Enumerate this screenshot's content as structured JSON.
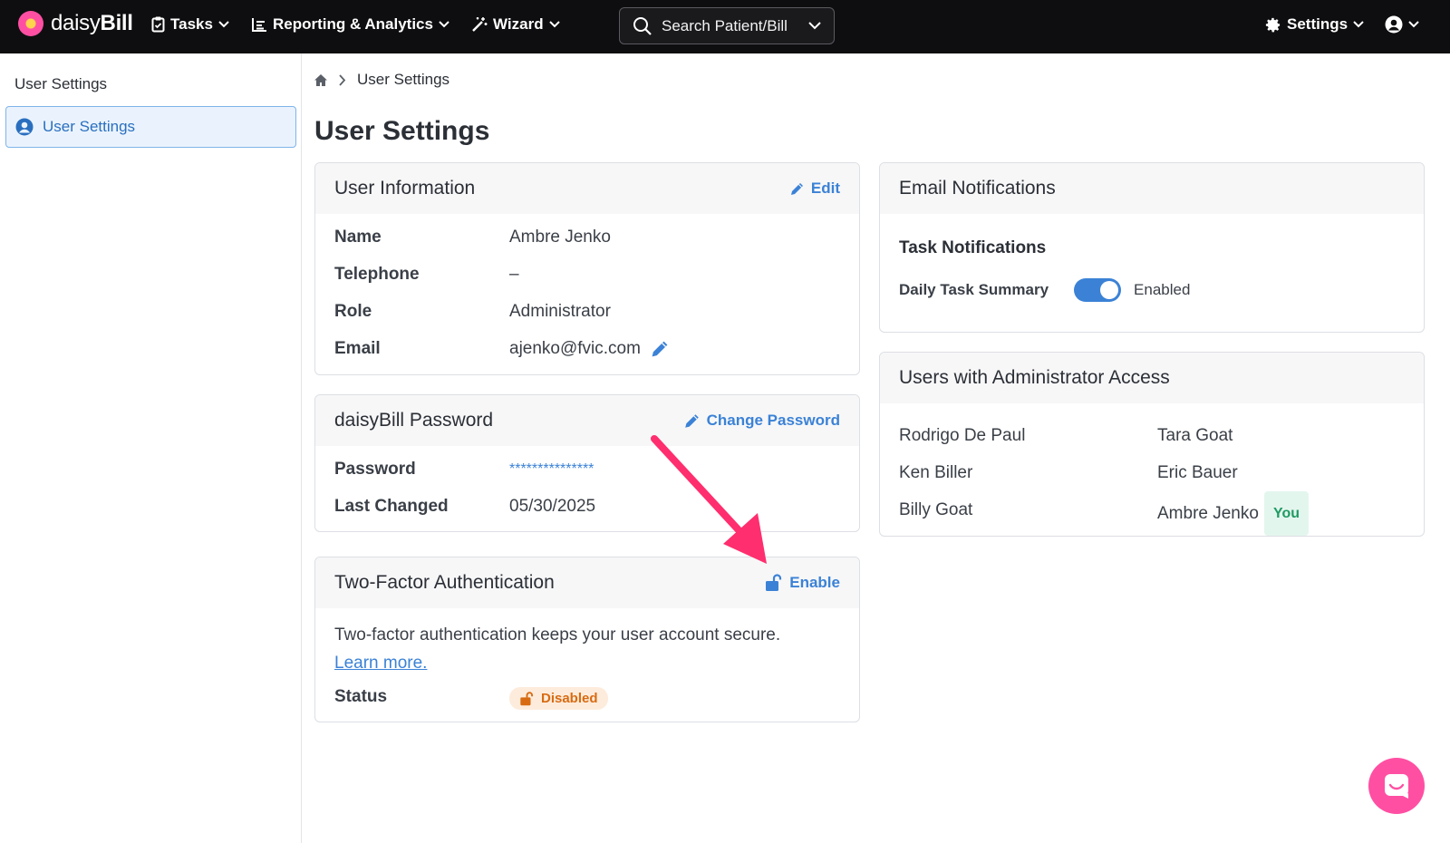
{
  "nav": {
    "logo_light": "daisy",
    "logo_bold": "Bill",
    "tasks": "Tasks",
    "reporting": "Reporting & Analytics",
    "wizard": "Wizard",
    "search_placeholder": "Search Patient/Bill",
    "settings": "Settings"
  },
  "sidebar": {
    "title": "User Settings",
    "items": [
      {
        "label": "User Settings"
      }
    ]
  },
  "breadcrumb": {
    "current": "User Settings"
  },
  "page_title": "User Settings",
  "user_info": {
    "title": "User Information",
    "action": "Edit",
    "rows": [
      {
        "label": "Name",
        "value": "Ambre Jenko"
      },
      {
        "label": "Telephone",
        "value": "–"
      },
      {
        "label": "Role",
        "value": "Administrator"
      },
      {
        "label": "Email",
        "value": "ajenko@fvic.com"
      }
    ]
  },
  "password": {
    "title": "daisyBill Password",
    "action": "Change Password",
    "rows": [
      {
        "label": "Password",
        "value": "***************"
      },
      {
        "label": "Last Changed",
        "value": "05/30/2025"
      }
    ]
  },
  "two_factor": {
    "title": "Two-Factor Authentication",
    "action": "Enable",
    "description": "Two-factor authentication keeps your user account secure.",
    "learn_more": "Learn more.",
    "status_label": "Status",
    "status_value": "Disabled"
  },
  "email_notifications": {
    "title": "Email Notifications",
    "section": "Task Notifications",
    "daily_label": "Daily Task Summary",
    "daily_state": "Enabled"
  },
  "admins": {
    "title": "Users with Administrator Access",
    "left": [
      "Rodrigo De Paul",
      "Ken Biller",
      "Billy Goat"
    ],
    "right": [
      "Tara Goat",
      "Eric Bauer",
      "Ambre Jenko"
    ],
    "you_badge": "You"
  },
  "colors": {
    "accent": "#3b82d6",
    "brand_pink": "#ff4fa3",
    "nav_bg": "#0e0e10"
  }
}
